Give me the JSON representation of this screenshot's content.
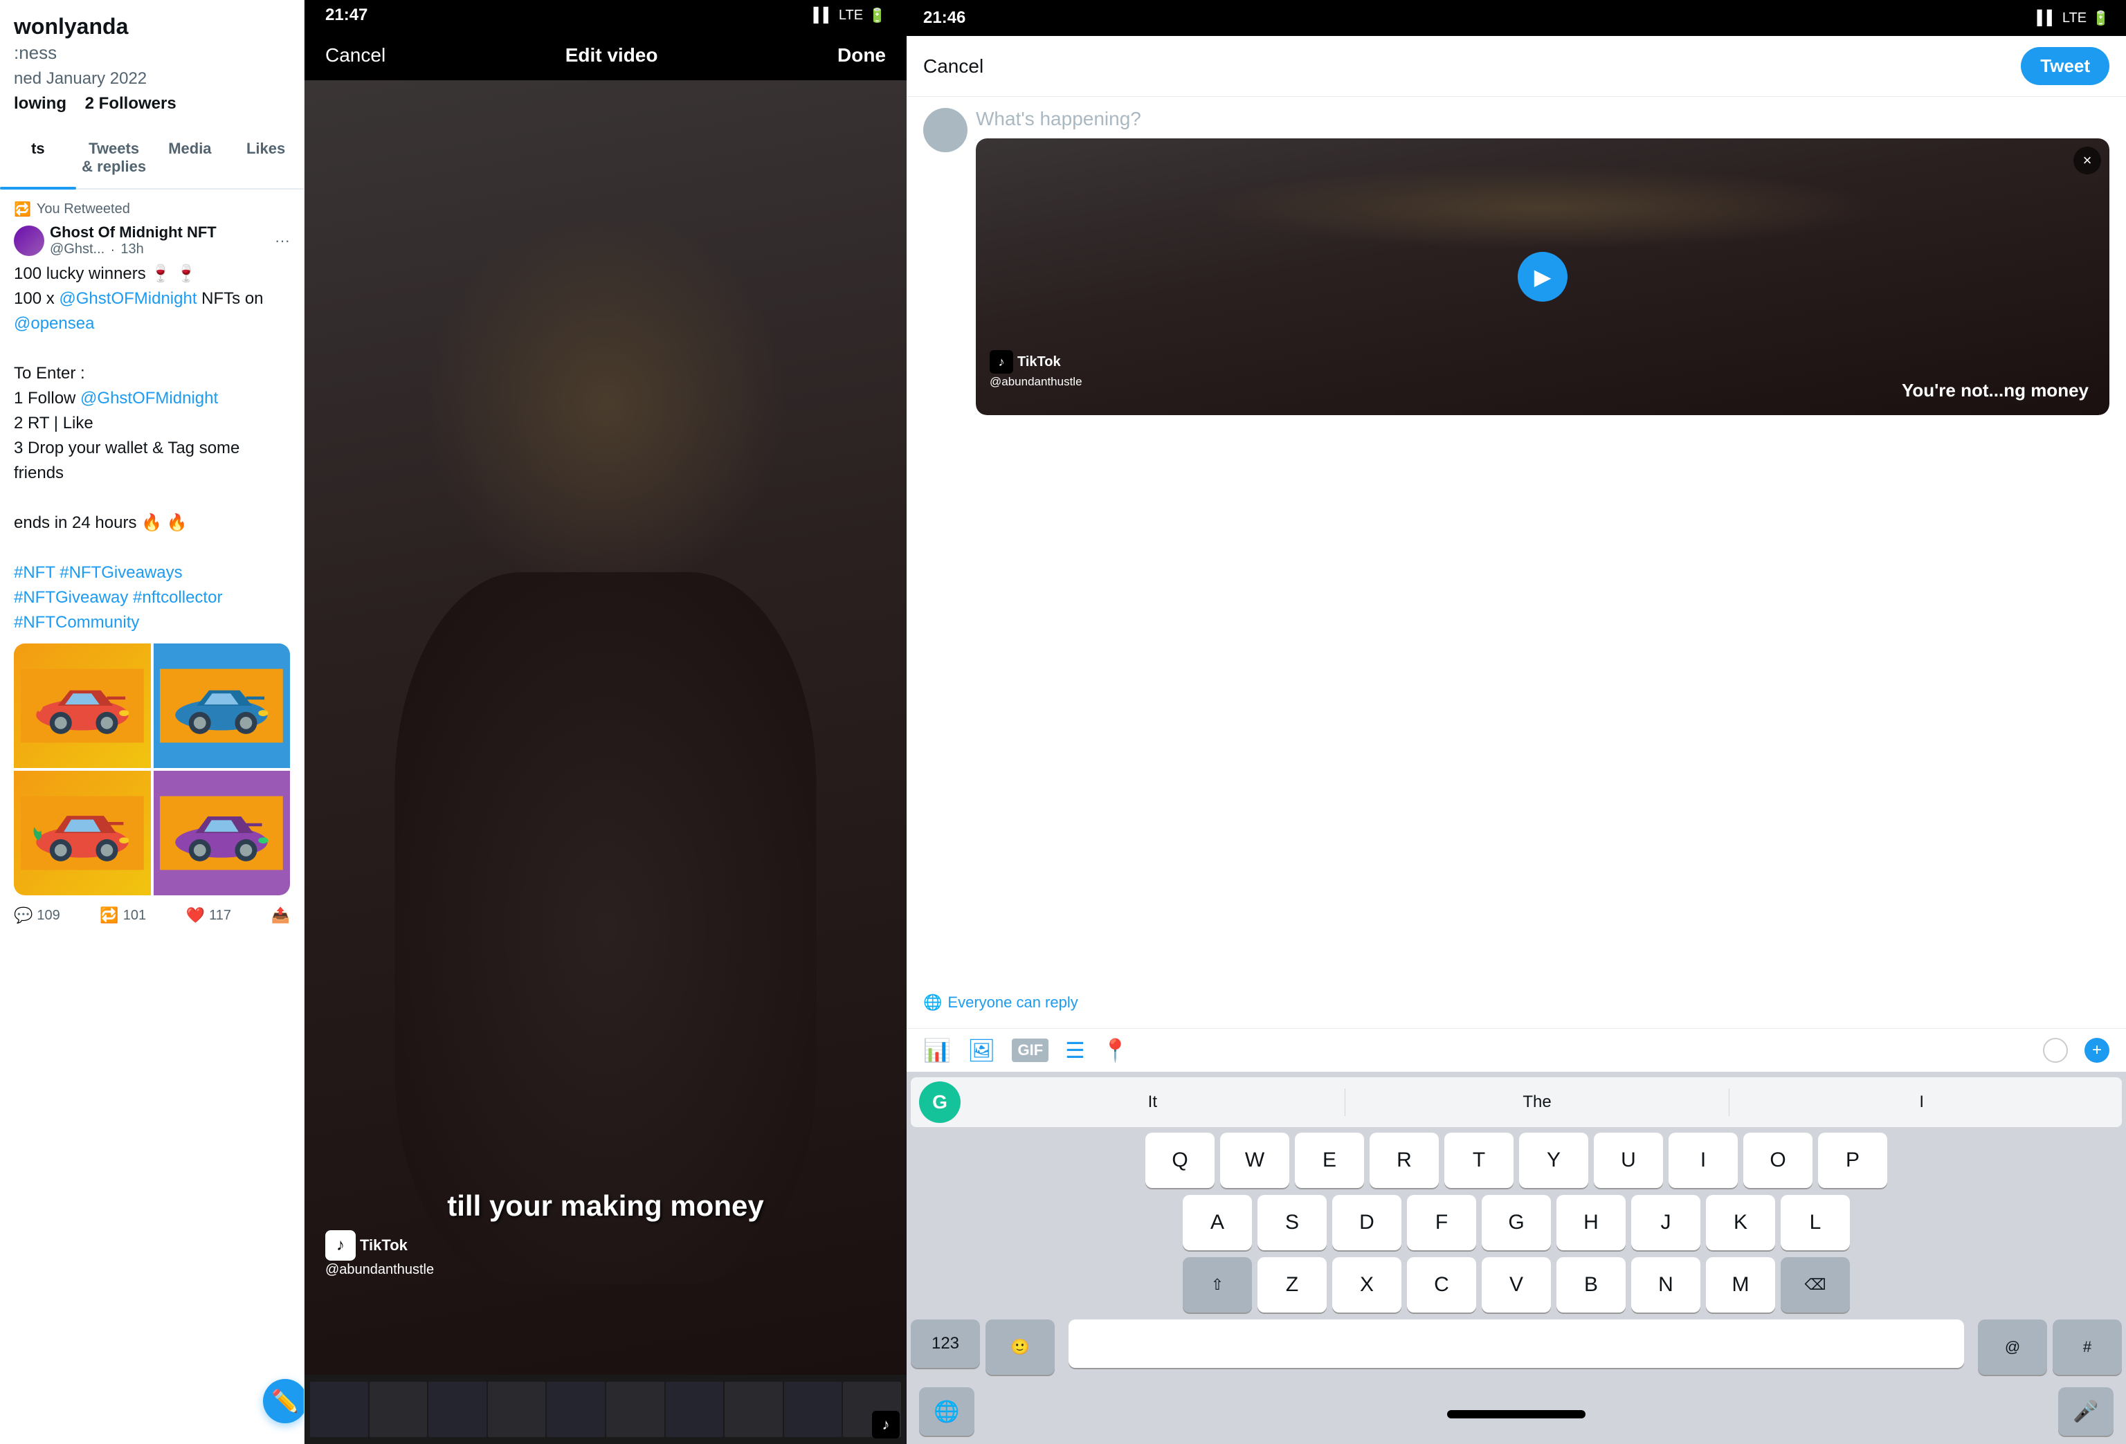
{
  "left": {
    "username": "wonlyanda",
    "handle": ":ness",
    "join_date": "ned January 2022",
    "following_label": "lowing",
    "following_count": "",
    "followers_label": "2 Followers",
    "tabs": [
      {
        "label": "ts",
        "active": true
      },
      {
        "label": "Tweets & replies",
        "active": false
      },
      {
        "label": "Media",
        "active": false
      },
      {
        "label": "Likes",
        "active": false
      }
    ],
    "retweet_label": "You Retweeted",
    "tweet": {
      "author_name": "Ghost Of Midnight NFT",
      "author_handle": "@Ghst...",
      "time": "13h",
      "line1": "100 lucky winners 🍷 🍷",
      "line2": "100 x",
      "mention1": "@GhstOFMidnight",
      "line3": " NFTs on",
      "mention2": "@opensea",
      "to_enter": "To Enter :",
      "step1a": "1 Follow ",
      "step1b": "@GhstOFMidnight",
      "step2": "2 RT | Like",
      "step3": "3 Drop your wallet & Tag some friends",
      "ends": "ends in 24 hours 🔥 🔥",
      "hashtags": "#NFT #NFTGiveaways #NFTGiveaway #nftcollector #NFTCommunity",
      "stats": {
        "comments": "109",
        "retweets": "101",
        "likes": "117"
      }
    }
  },
  "middle": {
    "status_time": "21:47",
    "status_signal": "▌▌",
    "status_lte": "LTE",
    "cancel_label": "Cancel",
    "title": "Edit video",
    "done_label": "Done",
    "caption": "till your making money",
    "tiktok_handle": "@abundanthustle"
  },
  "right": {
    "status_time": "21:46",
    "cancel_label": "Cancel",
    "tweet_btn": "Tweet",
    "placeholder": "What's happening?",
    "reply_setting": "Everyone can reply",
    "video_caption": "You're not...ng money",
    "tiktok_label": "TikTok",
    "tiktok_handle": "@abundanthustle",
    "close_icon": "×",
    "keyboard": {
      "suggestions": [
        "It",
        "The",
        "I"
      ],
      "row1": [
        "Q",
        "W",
        "E",
        "R",
        "T",
        "Y",
        "U",
        "I",
        "O",
        "P"
      ],
      "row2": [
        "A",
        "S",
        "D",
        "F",
        "G",
        "H",
        "J",
        "K",
        "L"
      ],
      "row3": [
        "Z",
        "X",
        "C",
        "V",
        "B",
        "N",
        "M"
      ],
      "shift_icon": "⇧",
      "delete_icon": "⌫",
      "num_label": "123",
      "emoji_icon": "🙂",
      "at_label": "@",
      "hash_label": "#",
      "globe_icon": "🌐",
      "mic_icon": "🎤"
    },
    "toolbar_icons": {
      "waveform": "📊",
      "image": "🖼",
      "gif": "GIF",
      "list": "☰",
      "location": "📍"
    }
  }
}
